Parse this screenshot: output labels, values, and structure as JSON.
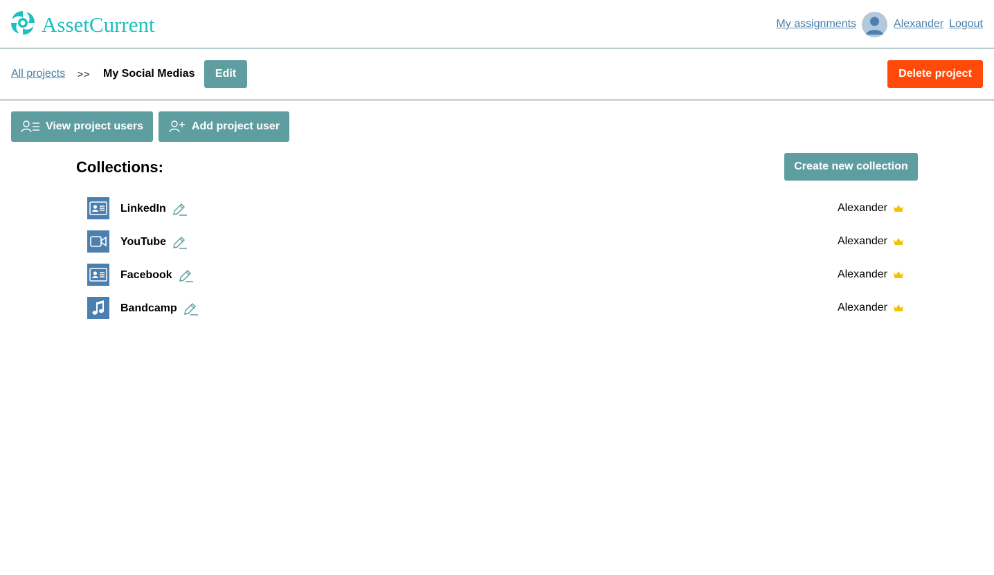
{
  "header": {
    "app_name": "AssetCurrent",
    "logo_icon": "swirl-logo-icon",
    "my_assignments": "My assignments",
    "user_name": "Alexander",
    "logout": "Logout",
    "brand_color": "#1fbfbf"
  },
  "breadcrumb": {
    "all_projects": "All projects",
    "separator": ">>",
    "current": "My Social Medias",
    "edit_label": "Edit",
    "delete_label": "Delete project"
  },
  "actions": {
    "view_users": "View project users",
    "add_user": "Add project user"
  },
  "collections": {
    "title": "Collections:",
    "create_label": "Create new collection",
    "items": [
      {
        "name": "LinkedIn",
        "icon": "id-card-icon",
        "owner": "Alexander"
      },
      {
        "name": "YouTube",
        "icon": "video-camera-icon",
        "owner": "Alexander"
      },
      {
        "name": "Facebook",
        "icon": "id-card-icon",
        "owner": "Alexander"
      },
      {
        "name": "Bandcamp",
        "icon": "music-note-icon",
        "owner": "Alexander"
      }
    ]
  },
  "colors": {
    "primary_button": "#5f9ea0",
    "danger_button": "#ff4a0a",
    "icon_tile": "#4a7fb0",
    "link": "#4a7fa8",
    "crown": "#f2c200"
  }
}
